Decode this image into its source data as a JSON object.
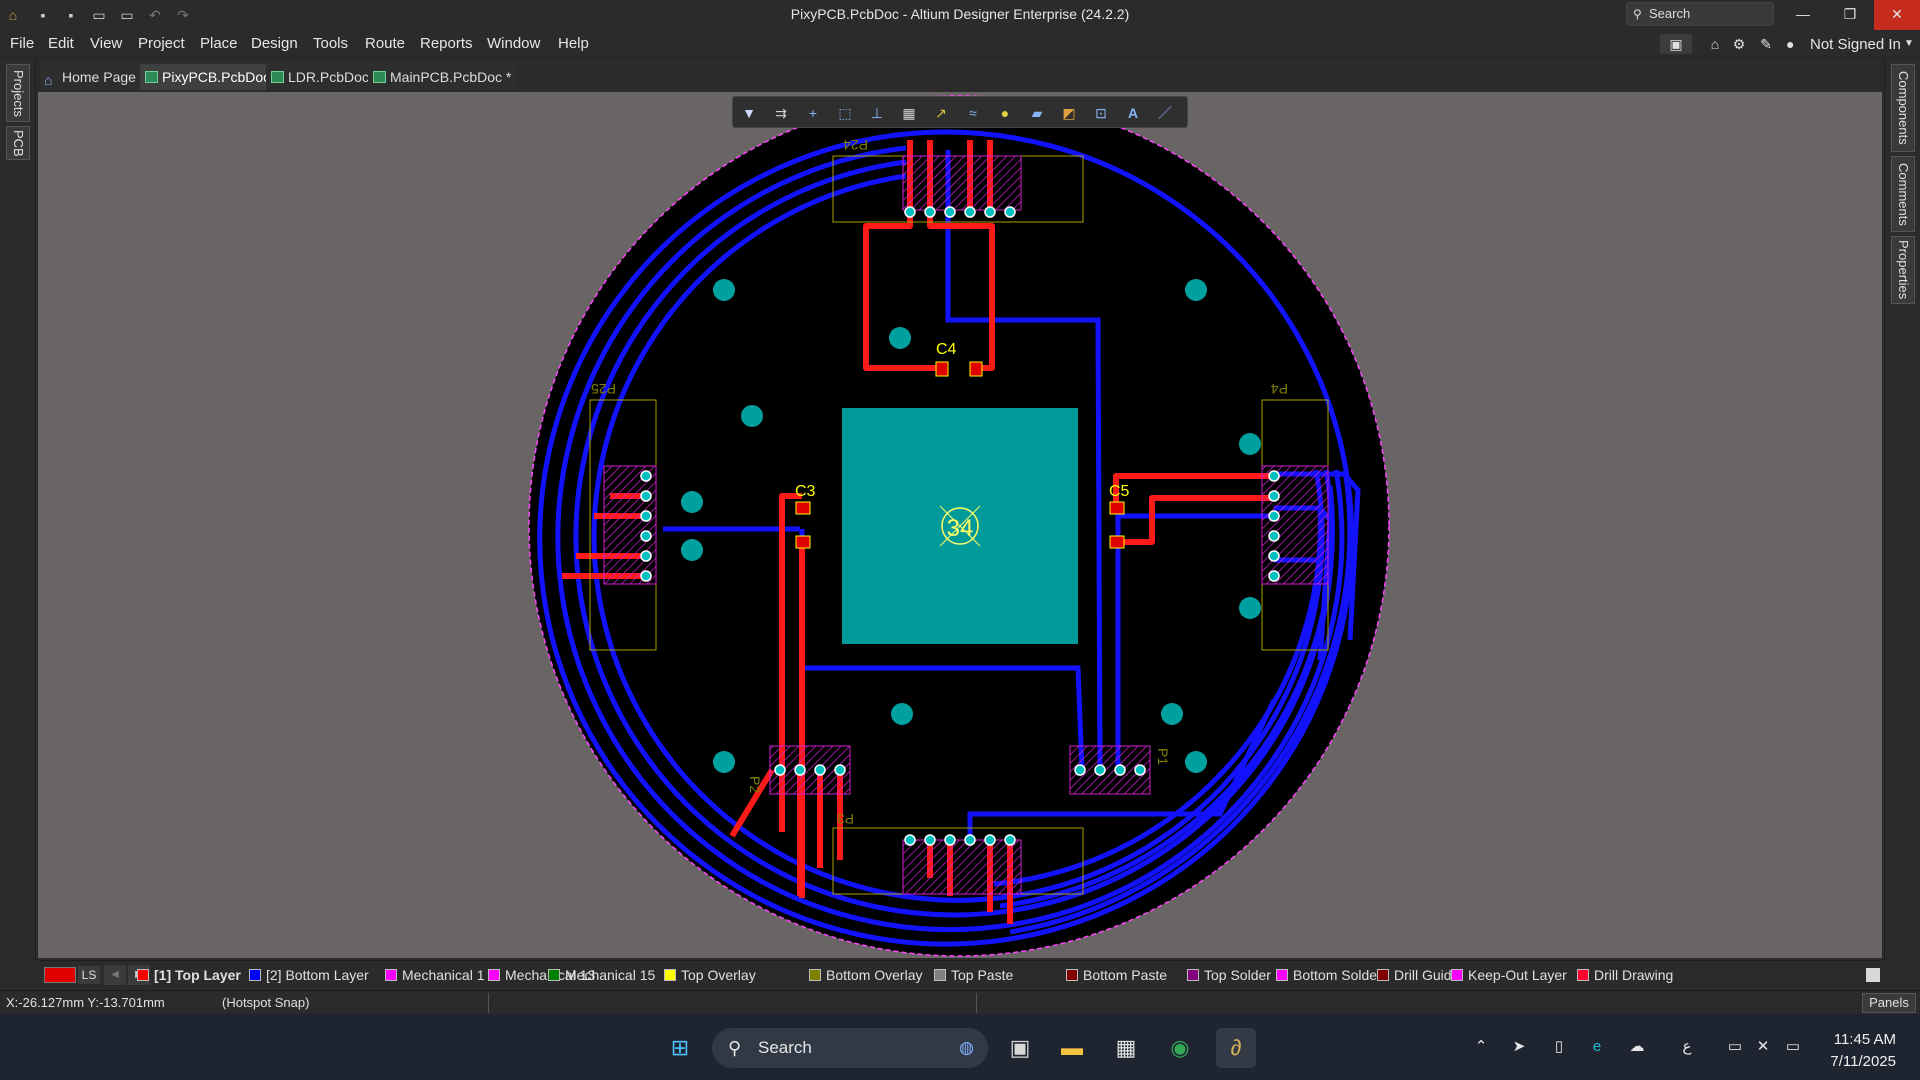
{
  "window": {
    "title": "PixyPCB.PcbDoc - Altium Designer Enterprise (24.2.2)",
    "search_placeholder": "Search"
  },
  "menu": [
    "File",
    "Edit",
    "View",
    "Project",
    "Place",
    "Design",
    "Tools",
    "Route",
    "Reports",
    "Window",
    "Help"
  ],
  "user": "Not Signed In",
  "left_panels": [
    "Projects",
    "PCB"
  ],
  "right_panels": [
    "Components",
    "Comments",
    "Properties"
  ],
  "tabs": [
    {
      "label": "Home Page"
    },
    {
      "label": "PixyPCB.PcbDoc"
    },
    {
      "label": "LDR.PcbDoc"
    },
    {
      "label": "MainPCB.PcbDoc *"
    }
  ],
  "pcb": {
    "designators": {
      "c4": "C4",
      "c3": "C3",
      "c5": "C5",
      "p24": "P24",
      "p25": "P25",
      "p4": "P4",
      "p3": "P3",
      "p2": "P2",
      "p1": "P1"
    },
    "ic_label": "34",
    "colors": {
      "board": "#000000",
      "top": "#ff1a1a",
      "bottom": "#1a1aff",
      "pad": "#008f8f",
      "overlay": "#ffff00",
      "outline": "#ff00ff"
    }
  },
  "layerbar": {
    "current": "LS",
    "layers": [
      {
        "name": "[1] Top Layer",
        "color": "#ff0000"
      },
      {
        "name": "[2] Bottom Layer",
        "color": "#0000ff"
      },
      {
        "name": "Mechanical 1",
        "color": "#ff00ff"
      },
      {
        "name": "Mechanical 13",
        "color": "#ff00ff"
      },
      {
        "name": "Mechanical 15",
        "color": "#008000"
      },
      {
        "name": "Top Overlay",
        "color": "#ffff00"
      },
      {
        "name": "Bottom Overlay",
        "color": "#808000"
      },
      {
        "name": "Top Paste",
        "color": "#808080"
      },
      {
        "name": "Bottom Paste",
        "color": "#800000"
      },
      {
        "name": "Top Solder",
        "color": "#800080"
      },
      {
        "name": "Bottom Solder",
        "color": "#ff00ff"
      },
      {
        "name": "Drill Guide",
        "color": "#800000"
      },
      {
        "name": "Keep-Out Layer",
        "color": "#ff00ff"
      },
      {
        "name": "Drill Drawing",
        "color": "#ff0030"
      }
    ]
  },
  "status": {
    "coords": "X:-26.127mm Y:-13.701mm",
    "snap": "(Hotspot Snap)",
    "panels": "Panels"
  },
  "taskbar": {
    "search": "Search",
    "time": "11:45 AM",
    "date": "7/11/2025"
  }
}
